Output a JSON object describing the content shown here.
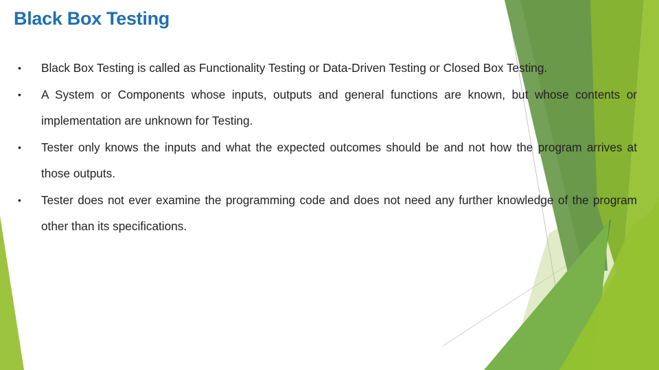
{
  "slide": {
    "title": "Black Box Testing",
    "bullet_glyph": "•",
    "bullets": [
      "Black Box Testing  is called as Functionality Testing or Data-Driven Testing or Closed Box Testing.",
      "A System or Components whose inputs, outputs and general functions are known, but whose contents or implementation are unknown for Testing.",
      "Tester only knows the inputs and what the expected outcomes should be and not how the program arrives at those outputs.",
      "Tester does not ever examine the programming code and does not need any further knowledge of the program other than its specifications."
    ]
  },
  "theme": {
    "title_color": "#1f6fb2",
    "green_dark": "#6a9a48",
    "green_mid": "#7bb44a",
    "green_yellow": "#8fbe2e",
    "green_light": "#dbe9bd",
    "green_deep": "#4c8a23"
  }
}
